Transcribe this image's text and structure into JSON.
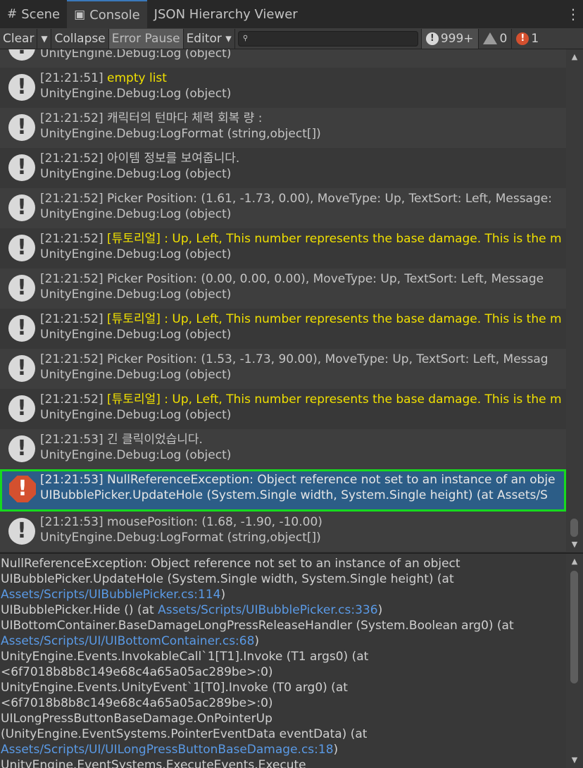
{
  "tabs": [
    {
      "icon": "#",
      "label": "Scene"
    },
    {
      "icon": "▣",
      "label": "Console"
    },
    {
      "icon": "",
      "label": "JSON Hierarchy Viewer"
    }
  ],
  "tab_menu": "⋮",
  "toolbar": {
    "clear": "Clear",
    "clear_arrow": "▼",
    "collapse": "Collapse",
    "error_pause": "Error Pause",
    "editor": "Editor ▾",
    "search_icon": "🔍",
    "search_value": "",
    "info_icon": "!",
    "info_count": "999+",
    "warn_count": "0",
    "error_icon": "!",
    "error_count": "1"
  },
  "logs": [
    {
      "l1": "",
      "l2": "UnityEngine.Debug:Log (object)",
      "type": "info"
    },
    {
      "l1": "[21:21:51] ",
      "l1_hl": "empty list",
      "l2": "UnityEngine.Debug:Log (object)",
      "type": "info"
    },
    {
      "l1": "[21:21:52] 캐릭터의 턴마다 체력 회복 량 :",
      "l1_hl": "",
      "l2": "UnityEngine.Debug:LogFormat (string,object[])",
      "type": "info"
    },
    {
      "l1": "[21:21:52] 아이템 정보를 보여줍니다.",
      "l1_hl": "",
      "l2": "UnityEngine.Debug:Log (object)",
      "type": "info"
    },
    {
      "l1": "[21:21:52] Picker Position: (1.61, -1.73, 0.00), MoveType: Up, TextSort: Left, Message:",
      "l1_hl": "",
      "l2": "UnityEngine.Debug:Log (object)",
      "type": "info"
    },
    {
      "l1": "[21:21:52] ",
      "l1_hl": "[튜토리얼] : Up, Left, This number represents the base damage. This is the m",
      "l2": "UnityEngine.Debug:Log (object)",
      "type": "info"
    },
    {
      "l1": "[21:21:52] Picker Position: (0.00, 0.00, 0.00), MoveType: Up, TextSort: Left, Message",
      "l1_hl": "",
      "l2": "UnityEngine.Debug:Log (object)",
      "type": "info"
    },
    {
      "l1": "[21:21:52] ",
      "l1_hl": "[튜토리얼] : Up, Left, This number represents the base damage. This is the m",
      "l2": "UnityEngine.Debug:Log (object)",
      "type": "info"
    },
    {
      "l1": "[21:21:52] Picker Position: (1.53, -1.73, 90.00), MoveType: Up, TextSort: Left, Messag",
      "l1_hl": "",
      "l2": "UnityEngine.Debug:Log (object)",
      "type": "info"
    },
    {
      "l1": "[21:21:52] ",
      "l1_hl": "[튜토리얼] : Up, Left, This number represents the base damage. This is the m",
      "l2": "UnityEngine.Debug:Log (object)",
      "type": "info"
    },
    {
      "l1": "[21:21:53] 긴 클릭이었습니다.",
      "l1_hl": "",
      "l2": "UnityEngine.Debug:Log (object)",
      "type": "info"
    },
    {
      "l1": "[21:21:53] NullReferenceException: Object reference not set to an instance of an obje",
      "l1_hl": "",
      "l2": "UIBubblePicker.UpdateHole (System.Single width, System.Single height) (at Assets/S",
      "type": "error"
    },
    {
      "l1": "[21:21:53] mousePosition: (1.68, -1.90, -10.00)",
      "l1_hl": "",
      "l2": "UnityEngine.Debug:LogFormat (string,object[])",
      "type": "info"
    }
  ],
  "detail": [
    {
      "text": "NullReferenceException: Object reference not set to an instance of an object",
      "link": ""
    },
    {
      "text": "UIBubblePicker.UpdateHole (System.Single width, System.Single height) (at",
      "link": ""
    },
    {
      "text": "",
      "link": "Assets/Scripts/UIBubblePicker.cs:114",
      "after": ")"
    },
    {
      "text": "UIBubblePicker.Hide () (at ",
      "link": "Assets/Scripts/UIBubblePicker.cs:336",
      "after": ")"
    },
    {
      "text": "UIBottomContainer.BaseDamageLongPressReleaseHandler (System.Boolean arg0) (at",
      "link": ""
    },
    {
      "text": "",
      "link": "Assets/Scripts/UI/UIBottomContainer.cs:68",
      "after": ")"
    },
    {
      "text": "UnityEngine.Events.InvokableCall`1[T1].Invoke (T1 args0) (at",
      "link": ""
    },
    {
      "text": "<6f7018b8b8c149e68c4a65a05ac289be>:0)",
      "link": ""
    },
    {
      "text": "UnityEngine.Events.UnityEvent`1[T0].Invoke (T0 arg0) (at",
      "link": ""
    },
    {
      "text": "<6f7018b8b8c149e68c4a65a05ac289be>:0)",
      "link": ""
    },
    {
      "text": "UILongPressButtonBaseDamage.OnPointerUp",
      "link": ""
    },
    {
      "text": "(UnityEngine.EventSystems.PointerEventData eventData) (at",
      "link": ""
    },
    {
      "text": "",
      "link": "Assets/Scripts/UI/UILongPressButtonBaseDamage.cs:18",
      "after": ")"
    },
    {
      "text": "UnityEngine.EventSystems.ExecuteEvents.Execute",
      "link": ""
    }
  ]
}
